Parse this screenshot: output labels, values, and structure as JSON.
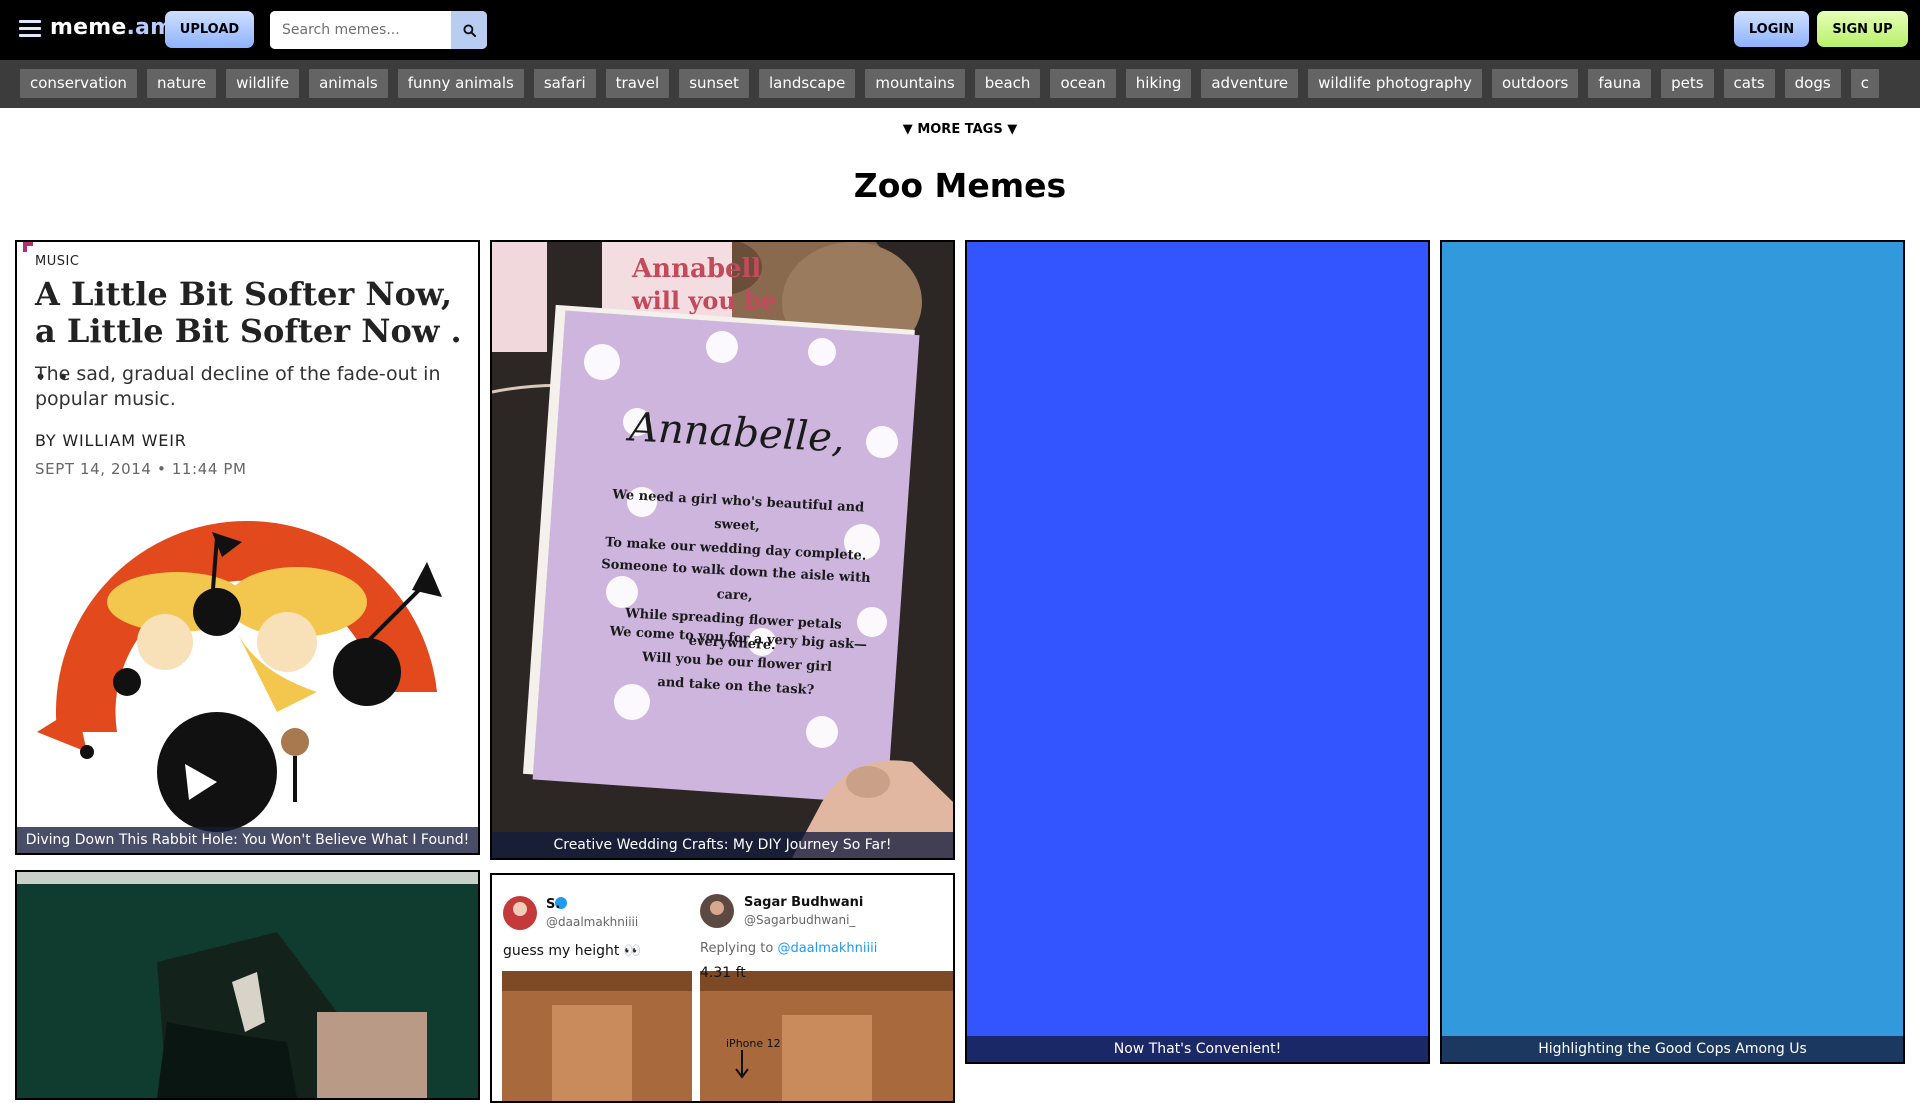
{
  "header": {
    "logo_main": "meme",
    "logo_tld": ".am",
    "upload_label": "UPLOAD",
    "search_placeholder": "Search memes...",
    "login_label": "LOGIN",
    "signup_label": "SIGN UP",
    "icons": {
      "menu": "hamburger-icon",
      "search": "search-icon"
    }
  },
  "tags": [
    "conservation",
    "nature",
    "wildlife",
    "animals",
    "funny animals",
    "safari",
    "travel",
    "sunset",
    "landscape",
    "mountains",
    "beach",
    "ocean",
    "hiking",
    "adventure",
    "wildlife photography",
    "outdoors",
    "fauna",
    "pets",
    "cats",
    "dogs",
    "c"
  ],
  "more_tags_label": "▼ MORE TAGS ▼",
  "page_title": "Zoo Memes",
  "cards": [
    {
      "caption": "Diving Down This Rabbit Hole: You Won't Believe What I Found!",
      "article": {
        "category": "MUSIC",
        "title": "A Little Bit Softer Now, a Little Bit Softer Now . . .",
        "subtitle": "The sad, gradual decline of the fade-out in popular music.",
        "byline": "BY WILLIAM WEIR",
        "date": "SEPT 14, 2014 • 11:44 PM"
      }
    },
    {
      "caption": "Creative Wedding Crafts: My DIY Journey So Far!",
      "invite": {
        "bg_sign": "Annabell",
        "bg_sign2": "will you be",
        "name": "Annabelle,",
        "lines1": [
          "We need a girl who's beautiful and sweet,",
          "To make our wedding day complete."
        ],
        "lines2": [
          "Someone to walk down the aisle with care,",
          "While spreading flower petals everywhere."
        ],
        "lines3": [
          "We come to you for a very big ask—",
          "Will you be our flower girl",
          "and take on the task?"
        ]
      }
    },
    {
      "caption": "Now That's Convenient!",
      "color": "#3355ff"
    },
    {
      "caption": "Highlighting the Good Cops Among Us",
      "color": "#3399dd"
    },
    {
      "caption": ""
    },
    {
      "caption": "",
      "tweet": {
        "left_name": "S.",
        "left_handle": "@daalmakhniiii",
        "left_text": "guess my height 👀",
        "right_name": "Sagar Budhwani",
        "right_handle": "@Sagarbudhwani_",
        "replying_prefix": "Replying to ",
        "replying_to": "@daalmakhniiii",
        "right_text": "4.31 ft",
        "phone_label": "iPhone 12"
      }
    }
  ]
}
